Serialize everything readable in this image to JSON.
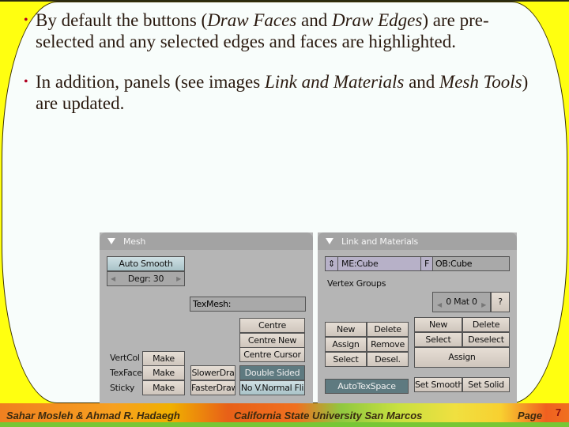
{
  "slide": {
    "bullets": [
      {
        "parts": [
          "By default the buttons (",
          "Draw Faces",
          " and ",
          "Draw Edges",
          ") are pre-selected and any selected edges and faces are highlighted."
        ]
      },
      {
        "parts": [
          "In addition, panels (see images ",
          "Link and Materials",
          " and ",
          "Mesh Tools",
          ") are updated."
        ]
      }
    ],
    "bullet_symbol": "•"
  },
  "mesh_panel": {
    "title": "Mesh",
    "auto_smooth": "Auto Smooth",
    "degr": "Degr: 30",
    "texmesh_label": "TexMesh:",
    "texmesh_value": "",
    "centre": "Centre",
    "centre_new": "Centre New",
    "centre_cursor": "Centre Cursor",
    "vertcol_label": "VertCol",
    "texface_label": "TexFace",
    "sticky_label": "Sticky",
    "make": "Make",
    "slower_draw": "SlowerDra",
    "faster_draw": "FasterDraw",
    "double_sided": "Double Sided",
    "no_vnormal_flip": "No V.Normal Fli"
  },
  "link_panel": {
    "title": "Link and Materials",
    "mesh_name": "ME:Cube",
    "f_button": "F",
    "object_name": "OB:Cube",
    "vertex_groups_label": "Vertex Groups",
    "mat_counter": "0 Mat 0",
    "help": "?",
    "vg_new": "New",
    "vg_delete": "Delete",
    "vg_assign": "Assign",
    "vg_remove": "Remove",
    "vg_select": "Select",
    "vg_desel": "Desel.",
    "mat_new": "New",
    "mat_delete": "Delete",
    "mat_select": "Select",
    "mat_deselect": "Deselect",
    "mat_assign": "Assign",
    "autotexspace": "AutoTexSpace",
    "set_smooth": "Set Smooth",
    "set_solid": "Set Solid"
  },
  "footer": {
    "authors": "Sahar Mosleh & Ahmad R. Hadaegh",
    "university": "California State University San Marcos",
    "page_label": "Page",
    "page_number": "7"
  },
  "colors": {
    "background_yellow": "#ffff10",
    "bullet_red": "#b00020",
    "footer_green": "#77c735"
  }
}
